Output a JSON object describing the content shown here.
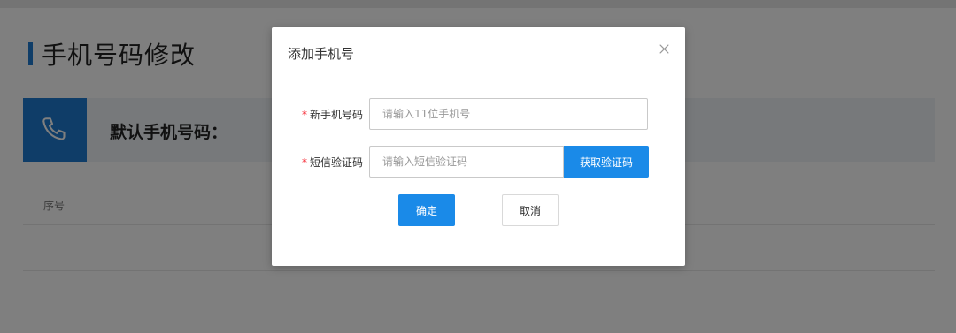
{
  "page": {
    "title": "手机号码修改",
    "default_phone_label": "默认手机号码：",
    "table": {
      "columns": [
        "序号"
      ]
    }
  },
  "modal": {
    "title": "添加手机号",
    "close_symbol": "×",
    "fields": {
      "phone": {
        "required_mark": "*",
        "label": "新手机号码",
        "value": "",
        "placeholder": "请输入11位手机号"
      },
      "sms": {
        "required_mark": "*",
        "label": "短信验证码",
        "value": "",
        "placeholder": "请输入短信验证码",
        "button_label": "获取验证码"
      }
    },
    "confirm_label": "确定",
    "cancel_label": "取消"
  },
  "colors": {
    "primary": "#1a8ae8",
    "icon_tile": "#1f7bd0",
    "required": "#f5222d"
  },
  "icons": {
    "card": "phone-icon",
    "close": "close-icon"
  }
}
